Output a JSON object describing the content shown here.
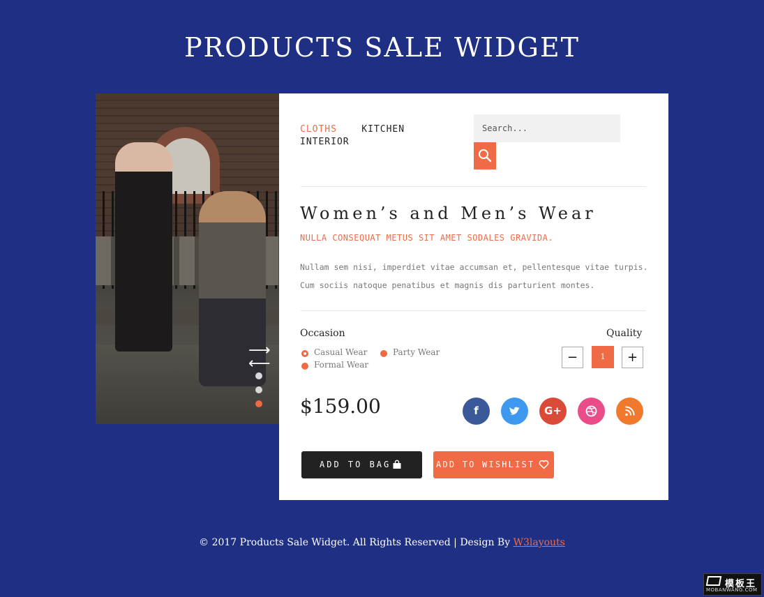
{
  "page": {
    "title": "PRODUCTS SALE WIDGET"
  },
  "colors": {
    "background": "#1f3084",
    "accent": "#ef6a45",
    "dark": "#222222",
    "facebook": "#3b5998",
    "twitter": "#3d98f0",
    "google_plus": "#db4a39",
    "dribbble": "#ea4c89",
    "rss": "#f0792d"
  },
  "slider": {
    "slide_count": 3,
    "active_slide": 3
  },
  "nav": {
    "items": [
      "CLOTHS",
      "KITCHEN",
      "INTERIOR"
    ],
    "active": "CLOTHS"
  },
  "search": {
    "placeholder": "Search...",
    "icon": "search-icon"
  },
  "product": {
    "title": "Women’s and Men’s Wear",
    "subtitle": "NULLA CONSEQUAT METUS SIT AMET SODALES GRAVIDA.",
    "description": "Nullam sem nisi, imperdiet vitae accumsan et, pellentesque vitae turpis. Cum sociis natoque penatibus et magnis dis parturient montes.",
    "price": "$159.00"
  },
  "occasion": {
    "label": "Occasion",
    "options": [
      "Casual Wear",
      "Party Wear",
      "Formal Wear"
    ],
    "selected": "Casual Wear"
  },
  "quantity": {
    "label": "Quality",
    "minus": "−",
    "value": "1",
    "plus": "+"
  },
  "social": [
    {
      "name": "facebook",
      "glyph": "f"
    },
    {
      "name": "twitter",
      "glyph": "t"
    },
    {
      "name": "google-plus",
      "glyph": "G+"
    },
    {
      "name": "dribbble",
      "glyph": ""
    },
    {
      "name": "rss",
      "glyph": ""
    }
  ],
  "actions": {
    "add_to_bag": "ADD TO BAG",
    "add_to_wishlist": "ADD TO WISHLIST"
  },
  "footer": {
    "text": "© 2017 Products Sale Widget. All Rights Reserved | Design By ",
    "link": "W3layouts"
  },
  "watermark": {
    "top": "模板王",
    "bottom": "MOBANWANG.COM"
  }
}
